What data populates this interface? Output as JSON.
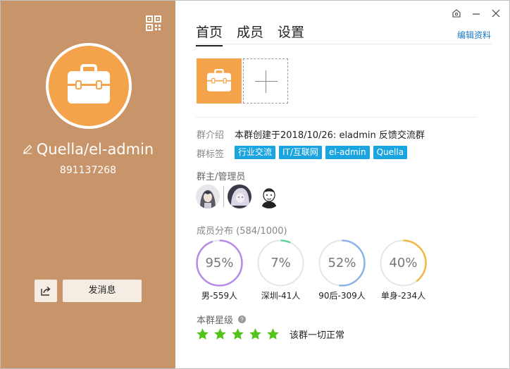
{
  "left": {
    "name": "Quella/el-admin",
    "group_id": "891137268",
    "send_message_label": "发消息"
  },
  "tabs": [
    {
      "label": "首页",
      "active": true
    },
    {
      "label": "成员",
      "active": false
    },
    {
      "label": "设置",
      "active": false
    }
  ],
  "edit_profile_label": "编辑资料",
  "intro": {
    "label": "群介绍",
    "text": "本群创建于2018/10/26:  eladmin 反馈交流群"
  },
  "tags": {
    "label": "群标签",
    "items": [
      "行业交流",
      "IT/互联网",
      "el-admin",
      "Quella"
    ]
  },
  "admins_label": "群主/管理员",
  "members": {
    "label": "成员分布",
    "count": "(584/1000)",
    "stats": [
      {
        "percent": "95%",
        "value": 95,
        "caption": "男-559人",
        "color": "#b48be6"
      },
      {
        "percent": "7%",
        "value": 7,
        "caption": "深圳-41人",
        "color": "#5bd6a0"
      },
      {
        "percent": "52%",
        "value": 52,
        "caption": "90后-309人",
        "color": "#8ab4e8"
      },
      {
        "percent": "40%",
        "value": 40,
        "caption": "单身-234人",
        "color": "#f5b545"
      }
    ]
  },
  "rating": {
    "label": "本群星级",
    "stars": 5,
    "status": "该群一切正常"
  },
  "colors": {
    "left_bg": "#c8956a",
    "accent_orange": "#f5a34a",
    "tag_blue": "#1aa4e0",
    "star_green": "#52c41a"
  }
}
